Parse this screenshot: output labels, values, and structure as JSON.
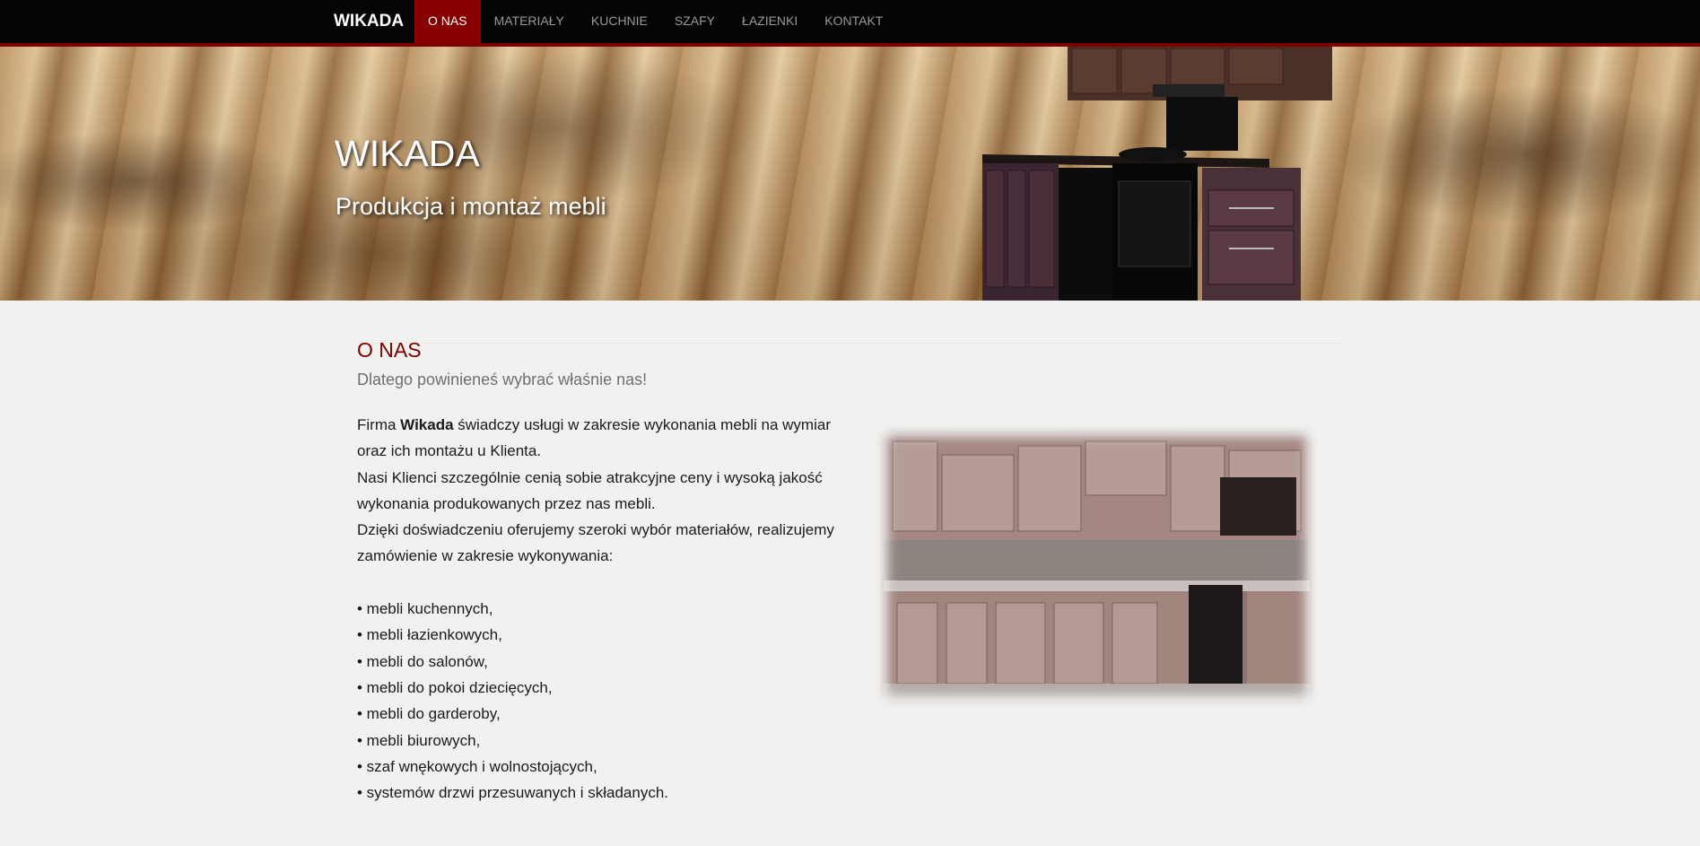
{
  "nav": {
    "brand": "WIKADA",
    "items": [
      {
        "label": "O NAS",
        "active": true
      },
      {
        "label": "MATERIAŁY",
        "active": false
      },
      {
        "label": "KUCHNIE",
        "active": false
      },
      {
        "label": "SZAFY",
        "active": false
      },
      {
        "label": "ŁAZIENKI",
        "active": false
      },
      {
        "label": "KONTAKT",
        "active": false
      }
    ]
  },
  "hero": {
    "title": "WIKADA",
    "subtitle": "Produkcja i montaż mebli"
  },
  "about": {
    "title": "O NAS",
    "subtitle": "Dlatego powinieneś wybrać właśnie nas!",
    "intro_before": "Firma ",
    "intro_company": "Wikada",
    "intro_after": " świadczy usługi w zakresie wykonania mebli na wymiar oraz ich montażu u Klienta.",
    "clients": "Nasi Klienci szczególnie cenią sobie atrakcyjne ceny i wysoką jakość wykonania produkowanych przez nas mebli.",
    "experience": "Dzięki doświadczeniu oferujemy szeroki wybór materiałów, realizujemy zamówienie w zakresie wykonywania:",
    "items": [
      "• mebli kuchennych,",
      "• mebli łazienkowych,",
      "• mebli do salonów,",
      "• mebli do pokoi dziecięcych,",
      "• mebli do garderoby,",
      "• mebli biurowych,",
      "• szaf wnękowych i wolnostojących,",
      "• systemów drzwi przesuwanych i składanych."
    ]
  },
  "colors": {
    "nav_bg": "#040404",
    "accent": "#870000",
    "heading": "#7a0000",
    "page_bg": "#f1f1f0"
  }
}
